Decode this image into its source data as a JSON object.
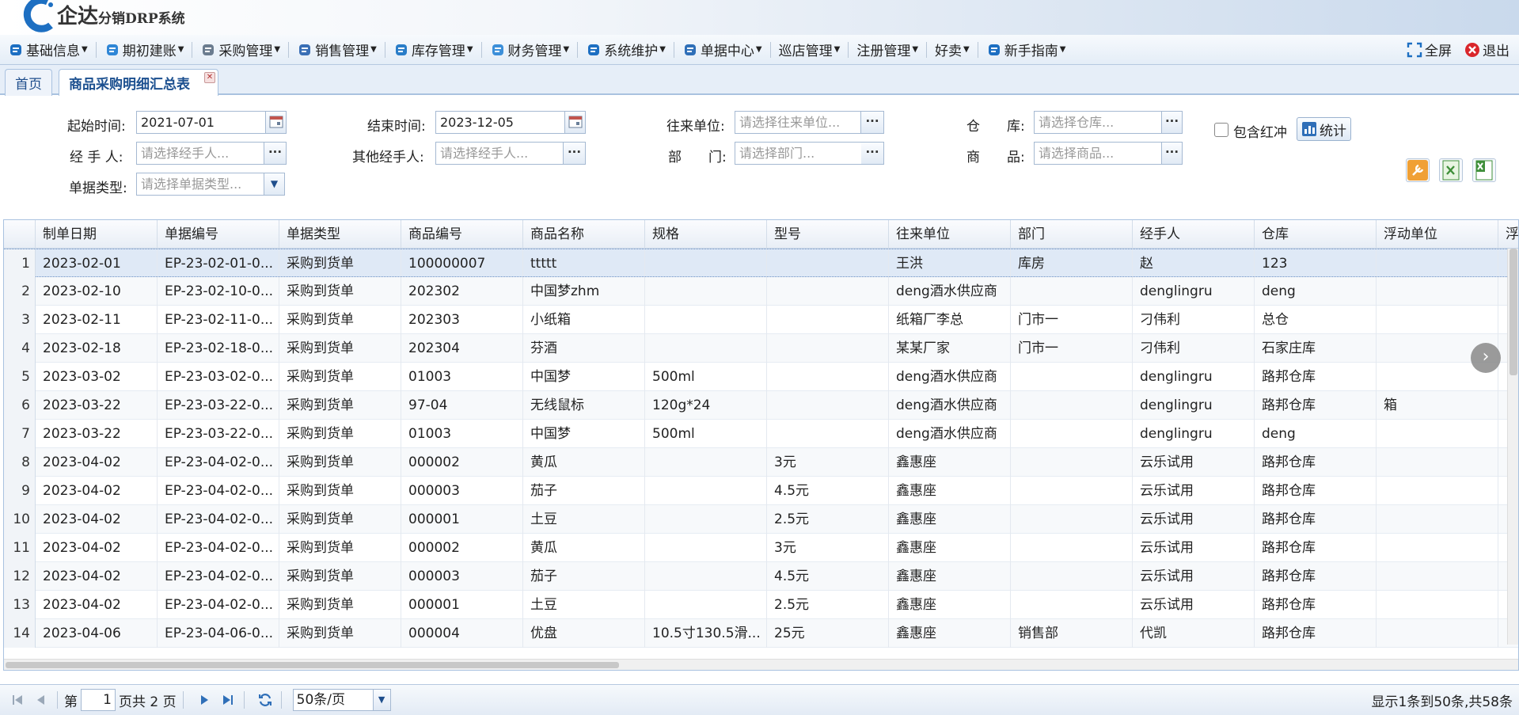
{
  "app": {
    "logo_main": "企达",
    "logo_sub": "分销DRP系统"
  },
  "menu": {
    "items": [
      {
        "label": "基础信息",
        "icon": "info-icon"
      },
      {
        "label": "期初建账",
        "icon": "ledger-icon"
      },
      {
        "label": "采购管理",
        "icon": "purchase-icon"
      },
      {
        "label": "销售管理",
        "icon": "sales-icon"
      },
      {
        "label": "库存管理",
        "icon": "inventory-icon"
      },
      {
        "label": "财务管理",
        "icon": "finance-icon"
      },
      {
        "label": "系统维护",
        "icon": "system-icon"
      },
      {
        "label": "单据中心",
        "icon": "document-icon"
      },
      {
        "label": "巡店管理",
        "icon": ""
      },
      {
        "label": "注册管理",
        "icon": ""
      },
      {
        "label": "好卖",
        "icon": ""
      },
      {
        "label": "新手指南",
        "icon": "help-icon"
      }
    ],
    "fullscreen": "全屏",
    "logout": "退出"
  },
  "tabs": {
    "home": "首页",
    "active": "商品采购明细汇总表"
  },
  "filters": {
    "start_label": "起始时间:",
    "start_value": "2021-07-01",
    "end_label": "结束时间:",
    "end_value": "2023-12-05",
    "partner_label": "往来单位:",
    "partner_ph": "请选择往来单位...",
    "warehouse_label": "仓　　库:",
    "warehouse_ph": "请选择仓库...",
    "handler_label": "经 手 人:",
    "handler_ph": "请选择经手人...",
    "other_handler_label": "其他经手人:",
    "other_handler_ph": "请选择经手人...",
    "dept_label": "部　　门:",
    "dept_ph": "请选择部门...",
    "product_label": "商　　品:",
    "product_ph": "请选择商品...",
    "doctype_label": "单据类型:",
    "doctype_ph": "请选择单据类型...",
    "include_red": "包含红冲",
    "stat_button": "统计"
  },
  "grid": {
    "columns": [
      "制单日期",
      "单据编号",
      "单据类型",
      "商品编号",
      "商品名称",
      "规格",
      "型号",
      "往来单位",
      "部门",
      "经手人",
      "仓库",
      "浮动单位",
      "浮"
    ],
    "rows": [
      [
        "1",
        "2023-02-01",
        "EP-23-02-01-0...",
        "采购到货单",
        "100000007",
        "ttttt",
        "",
        "",
        "王洪",
        "库房",
        "赵",
        "123",
        ""
      ],
      [
        "2",
        "2023-02-10",
        "EP-23-02-10-0...",
        "采购到货单",
        "202302",
        "中国梦zhm",
        "",
        "",
        "deng酒水供应商",
        "",
        "denglingru",
        "deng",
        ""
      ],
      [
        "3",
        "2023-02-11",
        "EP-23-02-11-0...",
        "采购到货单",
        "202303",
        "小纸箱",
        "",
        "",
        "纸箱厂李总",
        "门市一",
        "刁伟利",
        "总仓",
        ""
      ],
      [
        "4",
        "2023-02-18",
        "EP-23-02-18-0...",
        "采购到货单",
        "202304",
        "芬酒",
        "",
        "",
        "某某厂家",
        "门市一",
        "刁伟利",
        "石家庄库",
        ""
      ],
      [
        "5",
        "2023-03-02",
        "EP-23-03-02-0...",
        "采购到货单",
        "01003",
        "中国梦",
        "500ml",
        "",
        "deng酒水供应商",
        "",
        "denglingru",
        "路邦仓库",
        ""
      ],
      [
        "6",
        "2023-03-22",
        "EP-23-03-22-0...",
        "采购到货单",
        "97-04",
        "无线鼠标",
        "120g*24",
        "",
        "deng酒水供应商",
        "",
        "denglingru",
        "路邦仓库",
        "箱"
      ],
      [
        "7",
        "2023-03-22",
        "EP-23-03-22-0...",
        "采购到货单",
        "01003",
        "中国梦",
        "500ml",
        "",
        "deng酒水供应商",
        "",
        "denglingru",
        "deng",
        ""
      ],
      [
        "8",
        "2023-04-02",
        "EP-23-04-02-0...",
        "采购到货单",
        "000002",
        "黄瓜",
        "",
        "3元",
        "鑫惠座",
        "",
        "云乐试用",
        "路邦仓库",
        ""
      ],
      [
        "9",
        "2023-04-02",
        "EP-23-04-02-0...",
        "采购到货单",
        "000003",
        "茄子",
        "",
        "4.5元",
        "鑫惠座",
        "",
        "云乐试用",
        "路邦仓库",
        ""
      ],
      [
        "10",
        "2023-04-02",
        "EP-23-04-02-0...",
        "采购到货单",
        "000001",
        "土豆",
        "",
        "2.5元",
        "鑫惠座",
        "",
        "云乐试用",
        "路邦仓库",
        ""
      ],
      [
        "11",
        "2023-04-02",
        "EP-23-04-02-0...",
        "采购到货单",
        "000002",
        "黄瓜",
        "",
        "3元",
        "鑫惠座",
        "",
        "云乐试用",
        "路邦仓库",
        ""
      ],
      [
        "12",
        "2023-04-02",
        "EP-23-04-02-0...",
        "采购到货单",
        "000003",
        "茄子",
        "",
        "4.5元",
        "鑫惠座",
        "",
        "云乐试用",
        "路邦仓库",
        ""
      ],
      [
        "13",
        "2023-04-02",
        "EP-23-04-02-0...",
        "采购到货单",
        "000001",
        "土豆",
        "",
        "2.5元",
        "鑫惠座",
        "",
        "云乐试用",
        "路邦仓库",
        ""
      ],
      [
        "14",
        "2023-04-06",
        "EP-23-04-06-0...",
        "采购到货单",
        "000004",
        "优盘",
        "10.5寸130.5滑...",
        "25元",
        "鑫惠座",
        "销售部",
        "代凯",
        "路邦仓库",
        ""
      ]
    ]
  },
  "pager": {
    "page_prefix": "第",
    "page_value": "1",
    "page_suffix": "页共 2 页",
    "page_size": "50条/页",
    "info": "显示1条到50条,共58条"
  },
  "colors": {
    "accent": "#1b4f8f",
    "selected_row": "#dfe9f6",
    "header_bg": "#e4edf7"
  }
}
